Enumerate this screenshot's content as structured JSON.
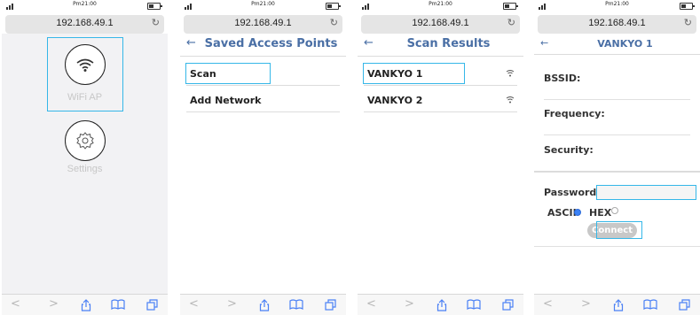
{
  "status": {
    "time": "Pm21:00"
  },
  "browser": {
    "url": "192.168.49.1",
    "reload_glyph": "C",
    "back_glyph": "<",
    "forward_glyph": ">"
  },
  "screens": {
    "home": {
      "items": [
        {
          "label": "WiFi AP",
          "icon": "wifi-icon"
        },
        {
          "label": "Settings",
          "icon": "gear-icon"
        }
      ]
    },
    "saved": {
      "title": "Saved Access Points",
      "back": "←",
      "rows": [
        "Scan",
        "Add Network"
      ]
    },
    "scan": {
      "title": "Scan Results",
      "back": "←",
      "rows": [
        "VANKYO 1",
        "VANKYO 2"
      ]
    },
    "detail": {
      "title": "VANKYO 1",
      "back": "←",
      "fields": [
        "BSSID:",
        "Frequency:",
        "Security:"
      ],
      "password_label": "Password:",
      "password_value": "",
      "ascii_label": "ASCII",
      "hex_label": "HEX",
      "connect_label": "Connect"
    }
  },
  "colors": {
    "highlight": "#35b7e8",
    "nav_title": "#4a6fa5",
    "toolbar_icon": "#4a80f5",
    "radio_selected": "#3b82f6"
  }
}
